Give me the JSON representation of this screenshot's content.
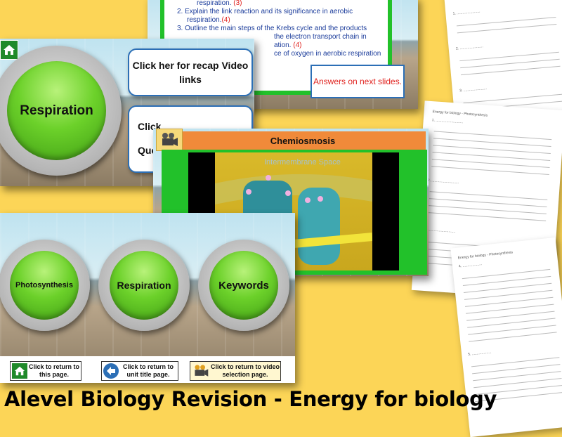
{
  "title": "Alevel Biology Revision - Energy for biology",
  "question_slide": {
    "items": [
      {
        "text": "respiration.",
        "mark": "(3)"
      },
      {
        "num": "2.",
        "text": "Explain the link reaction and its significance in aerobic respiration.",
        "mark": "(4)"
      },
      {
        "num": "3.",
        "text": "Outline the main steps of the Krebs cycle and the products",
        "mark": ""
      },
      {
        "text": "the electron transport chain in",
        "mark": ""
      },
      {
        "text": "ation.",
        "mark": "(4)"
      },
      {
        "text": "ce of oxygen in aerobic respiration",
        "mark": ""
      }
    ],
    "answers_button": "Answers on next slides."
  },
  "respiration_slide": {
    "main_button": "Respiration",
    "recap_callout": "Click her for recap Video links",
    "second_callout_line1": "Click",
    "second_callout_line2": "Que"
  },
  "video_slide": {
    "title": "Chemiosmosis",
    "video_caption": "Intermembrane Space"
  },
  "menu_slide": {
    "buttons": [
      "Photosynthesis",
      "Respiration",
      "Keywords"
    ],
    "nav": [
      {
        "label": "Click to return to this page.",
        "icon": "home-icon"
      },
      {
        "label": "Click to return to unit title page.",
        "icon": "back-arrow-icon"
      },
      {
        "label": "Click to return to video selection page.",
        "icon": "video-camera-icon"
      }
    ]
  },
  "colors": {
    "background": "#fcd557",
    "slide_green": "#22c12a",
    "title_orange": "#f08a3a",
    "button_green": "#6cd12a",
    "callout_blue": "#2c6fb6",
    "answers_red": "#e0201c"
  }
}
